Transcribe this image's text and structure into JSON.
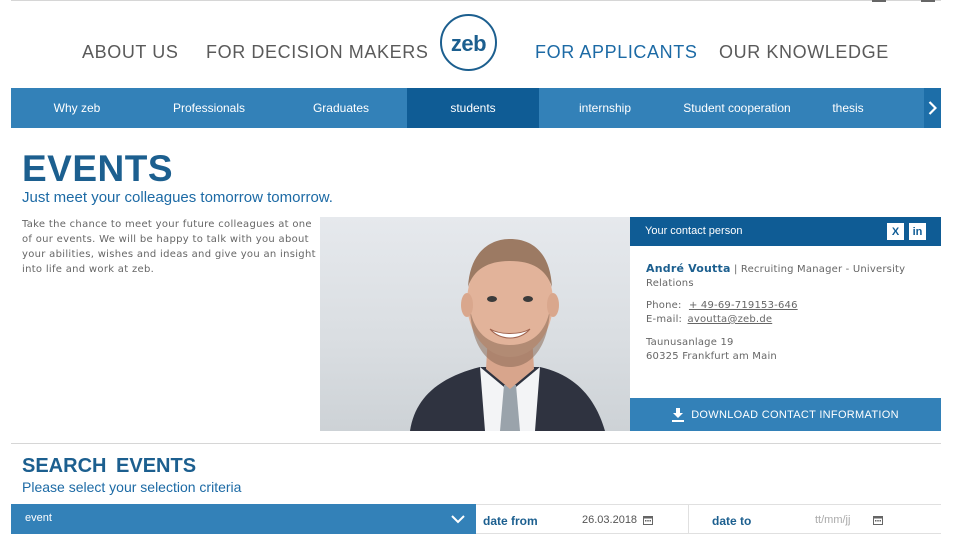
{
  "topnav": {
    "items": [
      {
        "label": "ABOUT US"
      },
      {
        "label": "FOR DECISION MAKERS"
      },
      {
        "label": "FOR APPLICANTS"
      },
      {
        "label": "OUR KNOWLEDGE"
      }
    ],
    "logo_text": "zeb"
  },
  "subnav": {
    "tabs": [
      {
        "label": "Why zeb"
      },
      {
        "label": "Professionals"
      },
      {
        "label": "Graduates"
      },
      {
        "label": "students"
      },
      {
        "label": "internship"
      },
      {
        "label": "Student cooperation"
      },
      {
        "label": "thesis"
      }
    ],
    "active_tab": "students"
  },
  "events": {
    "title": "EVENTS",
    "subtitle": "Just meet your colleagues tomorrow tomorrow.",
    "description": "Take the chance to meet your future colleagues at one of our events. We will be happy to talk with you about your abilities, wishes and ideas and give you an insight into life and work at zeb."
  },
  "contact": {
    "header": "Your contact person",
    "social": [
      "xing-icon",
      "linkedin-icon"
    ],
    "xing_glyph": "X",
    "linkedin_glyph": "in",
    "name": "André Voutta",
    "separator": " | ",
    "role": "Recruiting Manager - University Relations",
    "phone_label": "Phone:",
    "phone": "+ 49-69-719153-646",
    "email_label": "E-mail:",
    "email": "avoutta@zeb.de",
    "address_line1": "Taunusanlage 19",
    "address_line2": "60325 Frankfurt am Main",
    "download_label": "DOWNLOAD CONTACT INFORMATION"
  },
  "search": {
    "title": "SEARCH EVENTS",
    "subtitle": "Please select your selection criteria",
    "event_select_value": "event",
    "date_from_label": "date from",
    "date_from_value": "26.03.2018",
    "date_to_label": "date to",
    "date_to_placeholder": "tt/mm/jj"
  },
  "colors": {
    "brand_dark": "#0f5c95",
    "brand": "#3381b8",
    "title_blue": "#1c5f8f"
  }
}
